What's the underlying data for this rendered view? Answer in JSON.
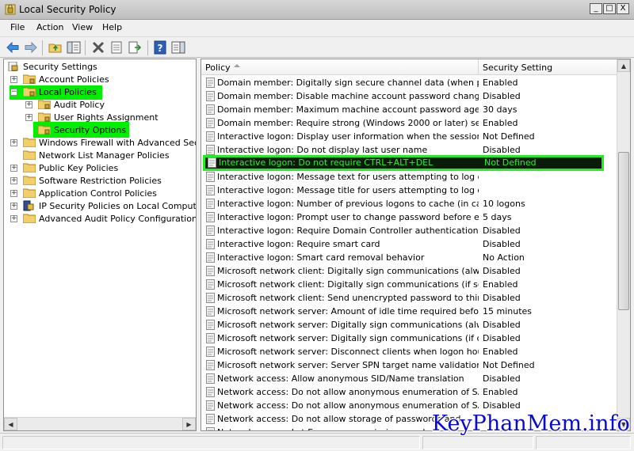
{
  "window": {
    "title": "Local Security Policy",
    "minimize": "_",
    "maximize": "□",
    "close": "X"
  },
  "menu": [
    "File",
    "Action",
    "View",
    "Help"
  ],
  "toolbar": {
    "icons": [
      "back-arrow-icon",
      "forward-arrow-icon",
      "up-folder-icon",
      "show-hide-tree-icon",
      "delete-icon",
      "properties-icon",
      "export-list-icon",
      "help-icon",
      "show-hide-action-pane-icon"
    ]
  },
  "tree": {
    "root": "Security Settings",
    "items": [
      {
        "label": "Account Policies",
        "expander": "+"
      },
      {
        "label": "Local Policies",
        "expander": "−"
      },
      {
        "label": "Audit Policy",
        "expander": "+"
      },
      {
        "label": "User Rights Assignment",
        "expander": "+"
      },
      {
        "label": "Security Options",
        "expander": ""
      },
      {
        "label": "Windows Firewall with Advanced Security",
        "expander": "+"
      },
      {
        "label": "Network List Manager Policies",
        "expander": ""
      },
      {
        "label": "Public Key Policies",
        "expander": "+"
      },
      {
        "label": "Software Restriction Policies",
        "expander": "+"
      },
      {
        "label": "Application Control Policies",
        "expander": "+"
      },
      {
        "label": "IP Security Policies on Local Computer",
        "expander": "+"
      },
      {
        "label": "Advanced Audit Policy Configuration",
        "expander": "+"
      }
    ]
  },
  "list": {
    "columns": [
      "Policy",
      "Security Setting"
    ],
    "rows": [
      {
        "policy": "Domain member: Digitally sign secure channel data (when possible)",
        "setting": "Enabled"
      },
      {
        "policy": "Domain member: Disable machine account password changes",
        "setting": "Disabled"
      },
      {
        "policy": "Domain member: Maximum machine account password age",
        "setting": "30 days"
      },
      {
        "policy": "Domain member: Require strong (Windows 2000 or later) session ...",
        "setting": "Enabled"
      },
      {
        "policy": "Interactive logon: Display user information when the session is lo...",
        "setting": "Not Defined"
      },
      {
        "policy": "Interactive logon: Do not display last user name",
        "setting": "Disabled"
      },
      {
        "policy": "Interactive logon: Do not require CTRL+ALT+DEL",
        "setting": "Not Defined"
      },
      {
        "policy": "Interactive logon: Message text for users attempting to log on",
        "setting": ""
      },
      {
        "policy": "Interactive logon: Message title for users attempting to log on",
        "setting": ""
      },
      {
        "policy": "Interactive logon: Number of previous logons to cache (in case d...",
        "setting": "10 logons"
      },
      {
        "policy": "Interactive logon: Prompt user to change password before expir...",
        "setting": "5 days"
      },
      {
        "policy": "Interactive logon: Require Domain Controller authentication to un...",
        "setting": "Disabled"
      },
      {
        "policy": "Interactive logon: Require smart card",
        "setting": "Disabled"
      },
      {
        "policy": "Interactive logon: Smart card removal behavior",
        "setting": "No Action"
      },
      {
        "policy": "Microsoft network client: Digitally sign communications (always)",
        "setting": "Disabled"
      },
      {
        "policy": "Microsoft network client: Digitally sign communications (if server a...",
        "setting": "Enabled"
      },
      {
        "policy": "Microsoft network client: Send unencrypted password to third-pa...",
        "setting": "Disabled"
      },
      {
        "policy": "Microsoft network server: Amount of idle time required before su...",
        "setting": "15 minutes"
      },
      {
        "policy": "Microsoft network server: Digitally sign communications (always)",
        "setting": "Disabled"
      },
      {
        "policy": "Microsoft network server: Digitally sign communications (if client a...",
        "setting": "Disabled"
      },
      {
        "policy": "Microsoft network server: Disconnect clients when logon hours e...",
        "setting": "Enabled"
      },
      {
        "policy": "Microsoft network server: Server SPN target name validation level",
        "setting": "Not Defined"
      },
      {
        "policy": "Network access: Allow anonymous SID/Name translation",
        "setting": "Disabled"
      },
      {
        "policy": "Network access: Do not allow anonymous enumeration of SAM ac...",
        "setting": "Enabled"
      },
      {
        "policy": "Network access: Do not allow anonymous enumeration of SAM ac...",
        "setting": "Disabled"
      },
      {
        "policy": "Network access: Do not allow storage of passwords and",
        "setting": ""
      },
      {
        "policy": "Network access: Let Everyone permissions apply to anon",
        "setting": ""
      }
    ]
  },
  "watermark": "KeyPhanMem.info",
  "colors": {
    "highlight": "#00ee00",
    "selected_bg": "#0a1b0a",
    "selected_text": "#2cf02c",
    "watermark": "#0a0acc"
  }
}
